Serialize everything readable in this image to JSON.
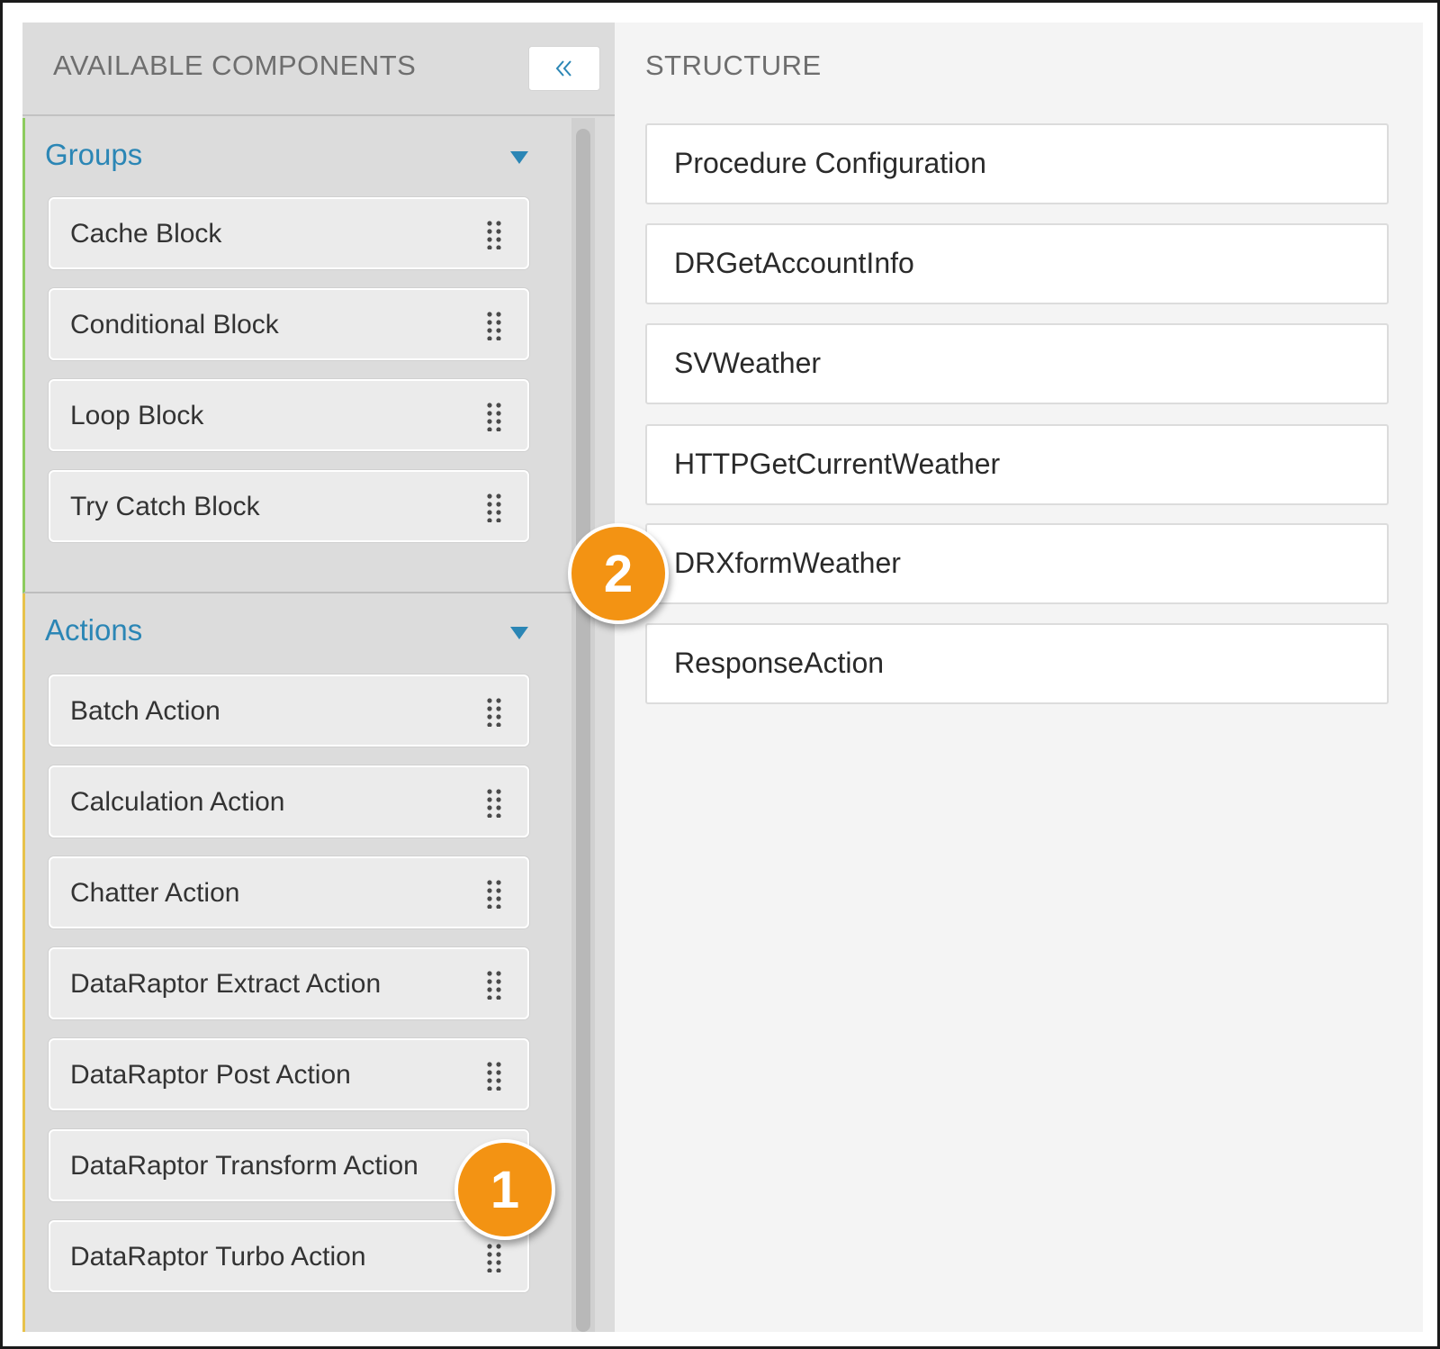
{
  "left_panel": {
    "title": "AVAILABLE COMPONENTS",
    "collapse_icon": "double-chevron-left-icon",
    "sections": [
      {
        "title": "Groups",
        "accent": "#8ccb5e",
        "items": [
          "Cache Block",
          "Conditional Block",
          "Loop Block",
          "Try Catch Block"
        ]
      },
      {
        "title": "Actions",
        "accent": "#e7c24b",
        "items": [
          "Batch Action",
          "Calculation Action",
          "Chatter Action",
          "DataRaptor Extract Action",
          "DataRaptor Post Action",
          "DataRaptor Transform Action",
          "DataRaptor Turbo Action"
        ]
      }
    ]
  },
  "right_panel": {
    "title": "STRUCTURE",
    "items": [
      "Procedure Configuration",
      "DRGetAccountInfo",
      "SVWeather",
      "HTTPGetCurrentWeather",
      "DRXformWeather",
      "ResponseAction"
    ]
  },
  "callouts": [
    "1",
    "2"
  ],
  "colors": {
    "section_title": "#2b86b5",
    "callout": "#f39313"
  }
}
